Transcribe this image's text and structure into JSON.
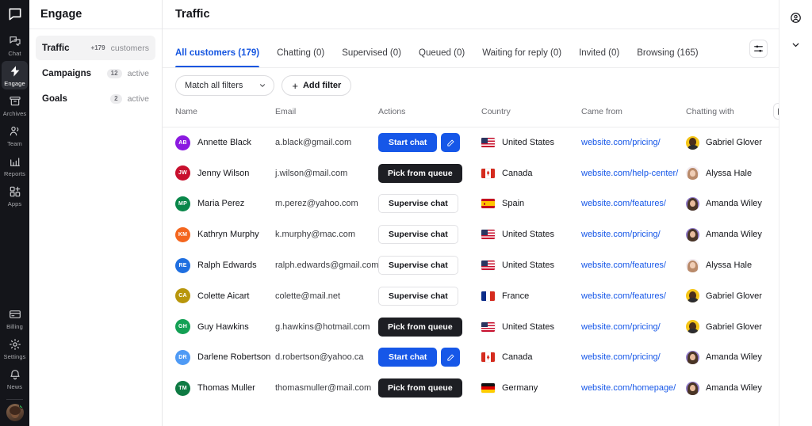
{
  "rail": {
    "logo_icon": "livechat-logo-icon",
    "items": [
      {
        "label": "Chat",
        "icon": "chat-icon",
        "active": false
      },
      {
        "label": "Engage",
        "icon": "bolt-icon",
        "active": true
      },
      {
        "label": "Archives",
        "icon": "archive-icon",
        "active": false
      },
      {
        "label": "Team",
        "icon": "team-icon",
        "active": false
      },
      {
        "label": "Reports",
        "icon": "reports-bar-chart-icon",
        "active": false
      },
      {
        "label": "Apps",
        "icon": "apps-grid-plus-icon",
        "active": false
      }
    ],
    "bottom_items": [
      {
        "label": "Billing",
        "icon": "billing-card-icon"
      },
      {
        "label": "Settings",
        "icon": "gear-icon"
      },
      {
        "label": "News",
        "icon": "bell-icon"
      }
    ],
    "profile_avatar": "user-avatar",
    "status": "online"
  },
  "nav2": {
    "title": "Engage",
    "items": [
      {
        "name": "Traffic",
        "badge": "+179",
        "badge_style": "plain",
        "sub": "customers",
        "active": true
      },
      {
        "name": "Campaigns",
        "badge": "12",
        "badge_style": "pill",
        "sub": "active",
        "active": false
      },
      {
        "name": "Goals",
        "badge": "2",
        "badge_style": "pill",
        "sub": "active",
        "active": false
      }
    ]
  },
  "header": {
    "title": "Traffic"
  },
  "tabs": [
    {
      "label": "All customers (179)",
      "active": true
    },
    {
      "label": "Chatting (0)",
      "active": false
    },
    {
      "label": "Supervised (0)",
      "active": false
    },
    {
      "label": "Queued (0)",
      "active": false
    },
    {
      "label": "Waiting for reply (0)",
      "active": false
    },
    {
      "label": "Invited (0)",
      "active": false
    },
    {
      "label": "Browsing (165)",
      "active": false
    }
  ],
  "tabs_action_icon": "sliders-filter-icon",
  "filters": {
    "match_label": "Match all filters",
    "match_caret_icon": "chevron-down-icon",
    "add_label": "Add filter",
    "add_icon": "plus-icon"
  },
  "table": {
    "columns": [
      "Name",
      "Email",
      "Actions",
      "Country",
      "Came from",
      "Chatting with"
    ],
    "columns_settings_icon": "columns-icon",
    "rows": [
      {
        "initials": "AB",
        "avatar_color": "#8b1ae0",
        "name": "Annette Black",
        "email": "a.black@gmail.com",
        "action": {
          "label": "Start chat",
          "style": "primary",
          "has_edit": true,
          "edit_icon": "pencil-icon"
        },
        "country": "United States",
        "flag": "us",
        "came_from": "website.com/pricing/",
        "agent": "Gabriel Glover",
        "agent_avatar": "gabriel"
      },
      {
        "initials": "JW",
        "avatar_color": "#c8102e",
        "name": "Jenny Wilson",
        "email": "j.wilson@mail.com",
        "action": {
          "label": "Pick from queue",
          "style": "dark",
          "has_edit": false
        },
        "country": "Canada",
        "flag": "ca",
        "came_from": "website.com/help-center/",
        "agent": "Alyssa Hale",
        "agent_avatar": "alyssa"
      },
      {
        "initials": "MP",
        "avatar_color": "#09874a",
        "name": "Maria Perez",
        "email": "m.perez@yahoo.com",
        "action": {
          "label": "Supervise chat",
          "style": "ghost",
          "has_edit": false
        },
        "country": "Spain",
        "flag": "es",
        "came_from": "website.com/features/",
        "agent": "Amanda Wiley",
        "agent_avatar": "amanda"
      },
      {
        "initials": "KM",
        "avatar_color": "#f4661e",
        "name": "Kathryn Murphy",
        "email": "k.murphy@mac.com",
        "action": {
          "label": "Supervise chat",
          "style": "ghost",
          "has_edit": false
        },
        "country": "United States",
        "flag": "us",
        "came_from": "website.com/pricing/",
        "agent": "Amanda Wiley",
        "agent_avatar": "amanda"
      },
      {
        "initials": "RE",
        "avatar_color": "#1f6fe0",
        "name": "Ralph Edwards",
        "email": "ralph.edwards@gmail.com",
        "action": {
          "label": "Supervise chat",
          "style": "ghost",
          "has_edit": false
        },
        "country": "United States",
        "flag": "us",
        "came_from": "website.com/features/",
        "agent": "Alyssa Hale",
        "agent_avatar": "alyssa"
      },
      {
        "initials": "CA",
        "avatar_color": "#b8960c",
        "name": "Colette Aicart",
        "email": "colette@mail.net",
        "action": {
          "label": "Supervise chat",
          "style": "ghost",
          "has_edit": false
        },
        "country": "France",
        "flag": "fr",
        "came_from": "website.com/features/",
        "agent": "Gabriel Glover",
        "agent_avatar": "gabriel"
      },
      {
        "initials": "GH",
        "avatar_color": "#13a054",
        "name": "Guy Hawkins",
        "email": "g.hawkins@hotmail.com",
        "action": {
          "label": "Pick from queue",
          "style": "dark",
          "has_edit": false
        },
        "country": "United States",
        "flag": "us",
        "came_from": "website.com/pricing/",
        "agent": "Gabriel Glover",
        "agent_avatar": "gabriel"
      },
      {
        "initials": "DR",
        "avatar_color": "#4e9af5",
        "name": "Darlene Robertson",
        "email": "d.robertson@yahoo.ca",
        "action": {
          "label": "Start chat",
          "style": "primary",
          "has_edit": true,
          "edit_icon": "pencil-icon"
        },
        "country": "Canada",
        "flag": "ca",
        "came_from": "website.com/pricing/",
        "agent": "Amanda Wiley",
        "agent_avatar": "amanda"
      },
      {
        "initials": "TM",
        "avatar_color": "#0e7a43",
        "name": "Thomas Muller",
        "email": "thomasmuller@mail.com",
        "action": {
          "label": "Pick from queue",
          "style": "dark",
          "has_edit": false
        },
        "country": "Germany",
        "flag": "de",
        "came_from": "website.com/homepage/",
        "agent": "Amanda Wiley",
        "agent_avatar": "amanda"
      }
    ]
  },
  "right_rail": {
    "items": [
      {
        "icon": "profile-circle-icon",
        "name": "profile"
      },
      {
        "icon": "chevron-down-icon",
        "name": "expand"
      }
    ]
  },
  "colors": {
    "accent": "#1657e8",
    "dark": "#1d1e23",
    "rail_bg": "#14151a"
  }
}
